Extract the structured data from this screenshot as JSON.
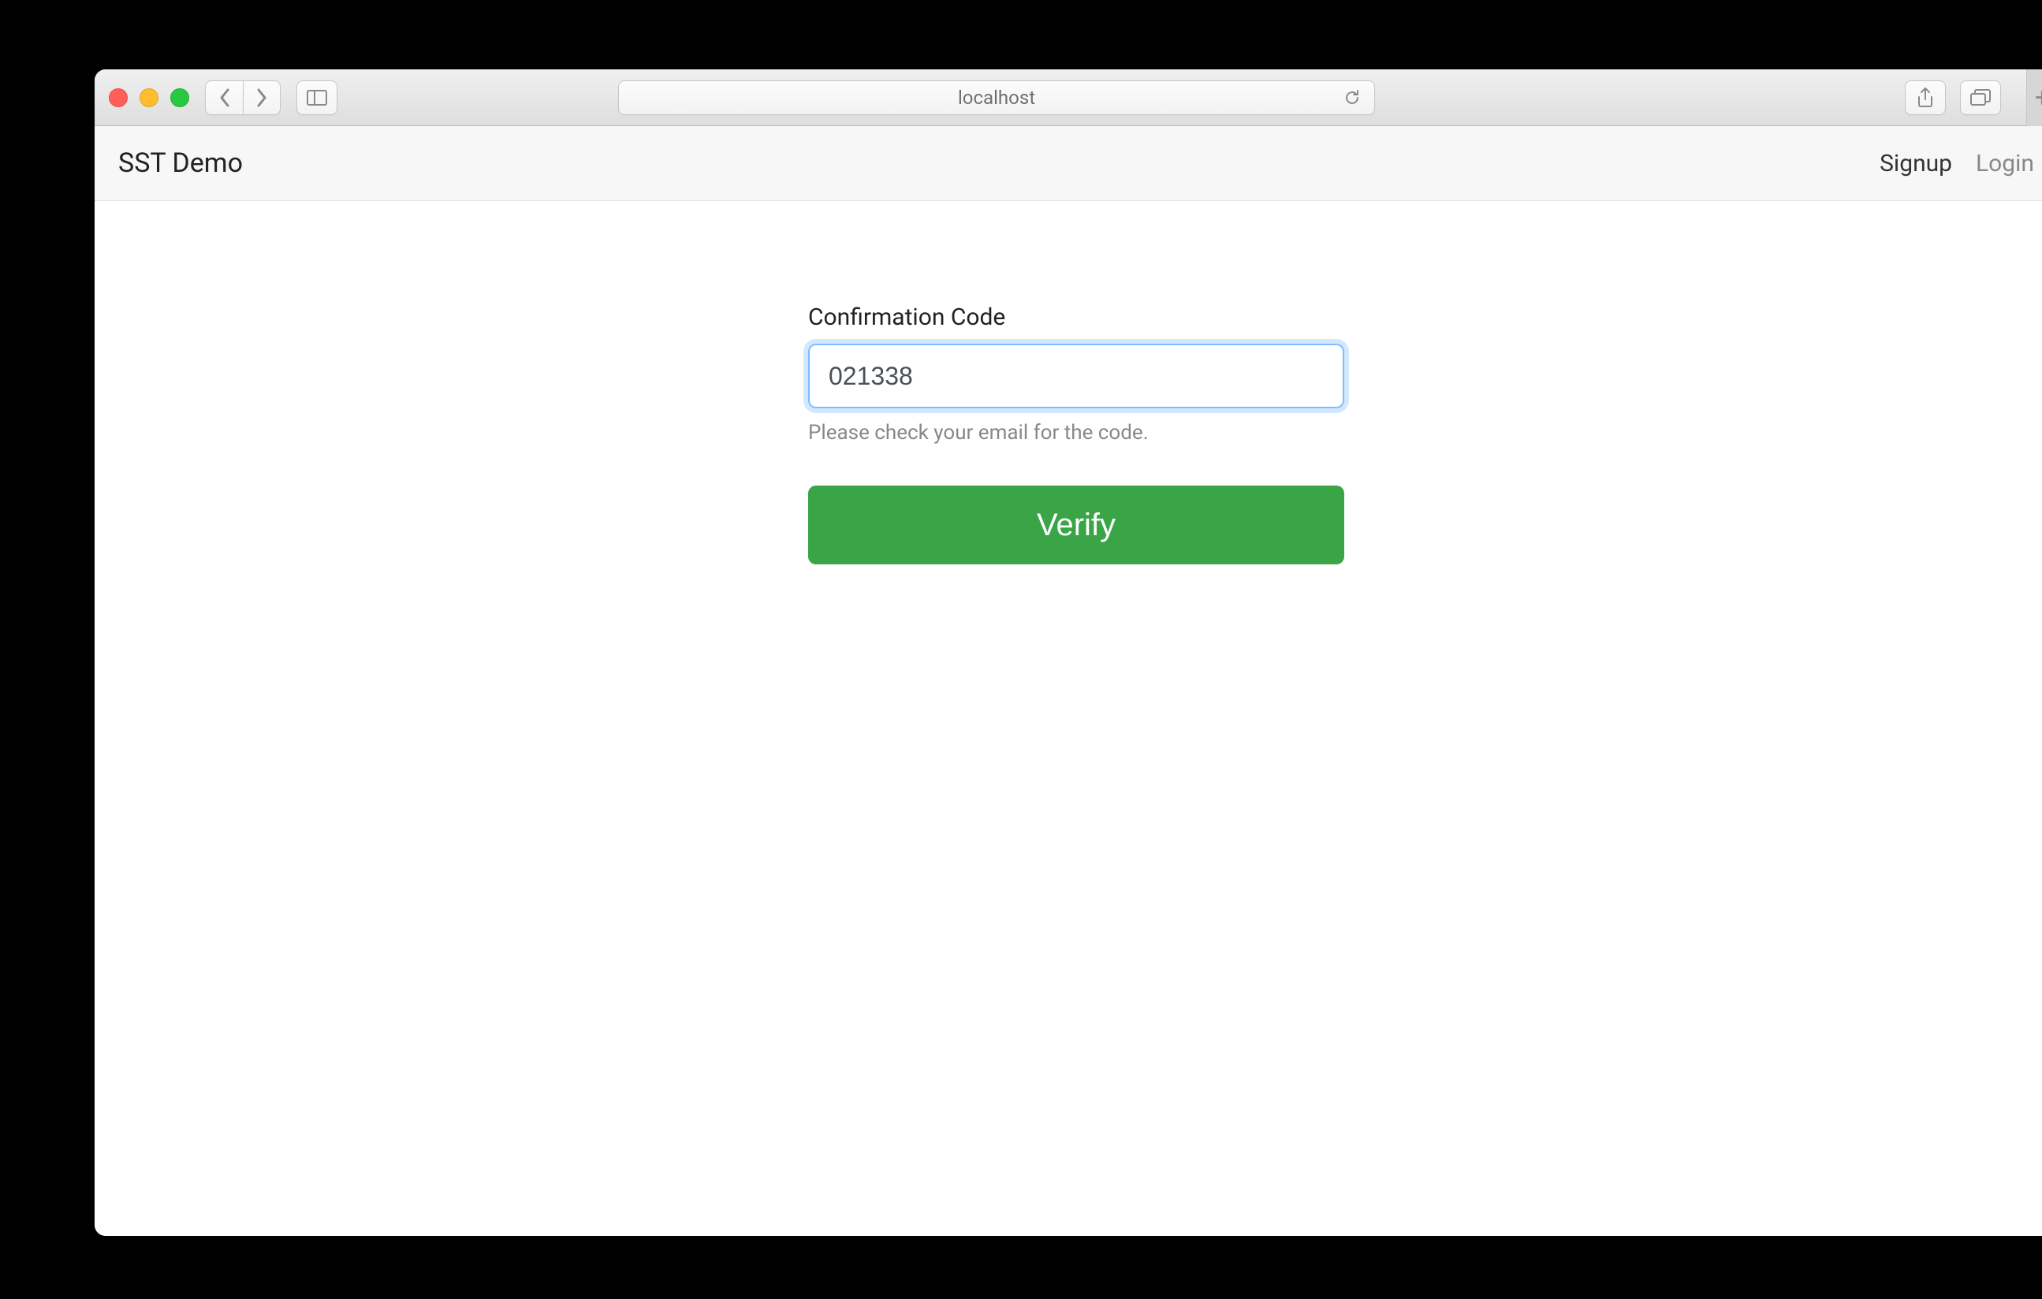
{
  "browser": {
    "url": "localhost"
  },
  "header": {
    "brand": "SST Demo",
    "signup": "Signup",
    "login": "Login"
  },
  "form": {
    "label": "Confirmation Code",
    "value": "021338",
    "help": "Please check your email for the code.",
    "verify": "Verify"
  }
}
